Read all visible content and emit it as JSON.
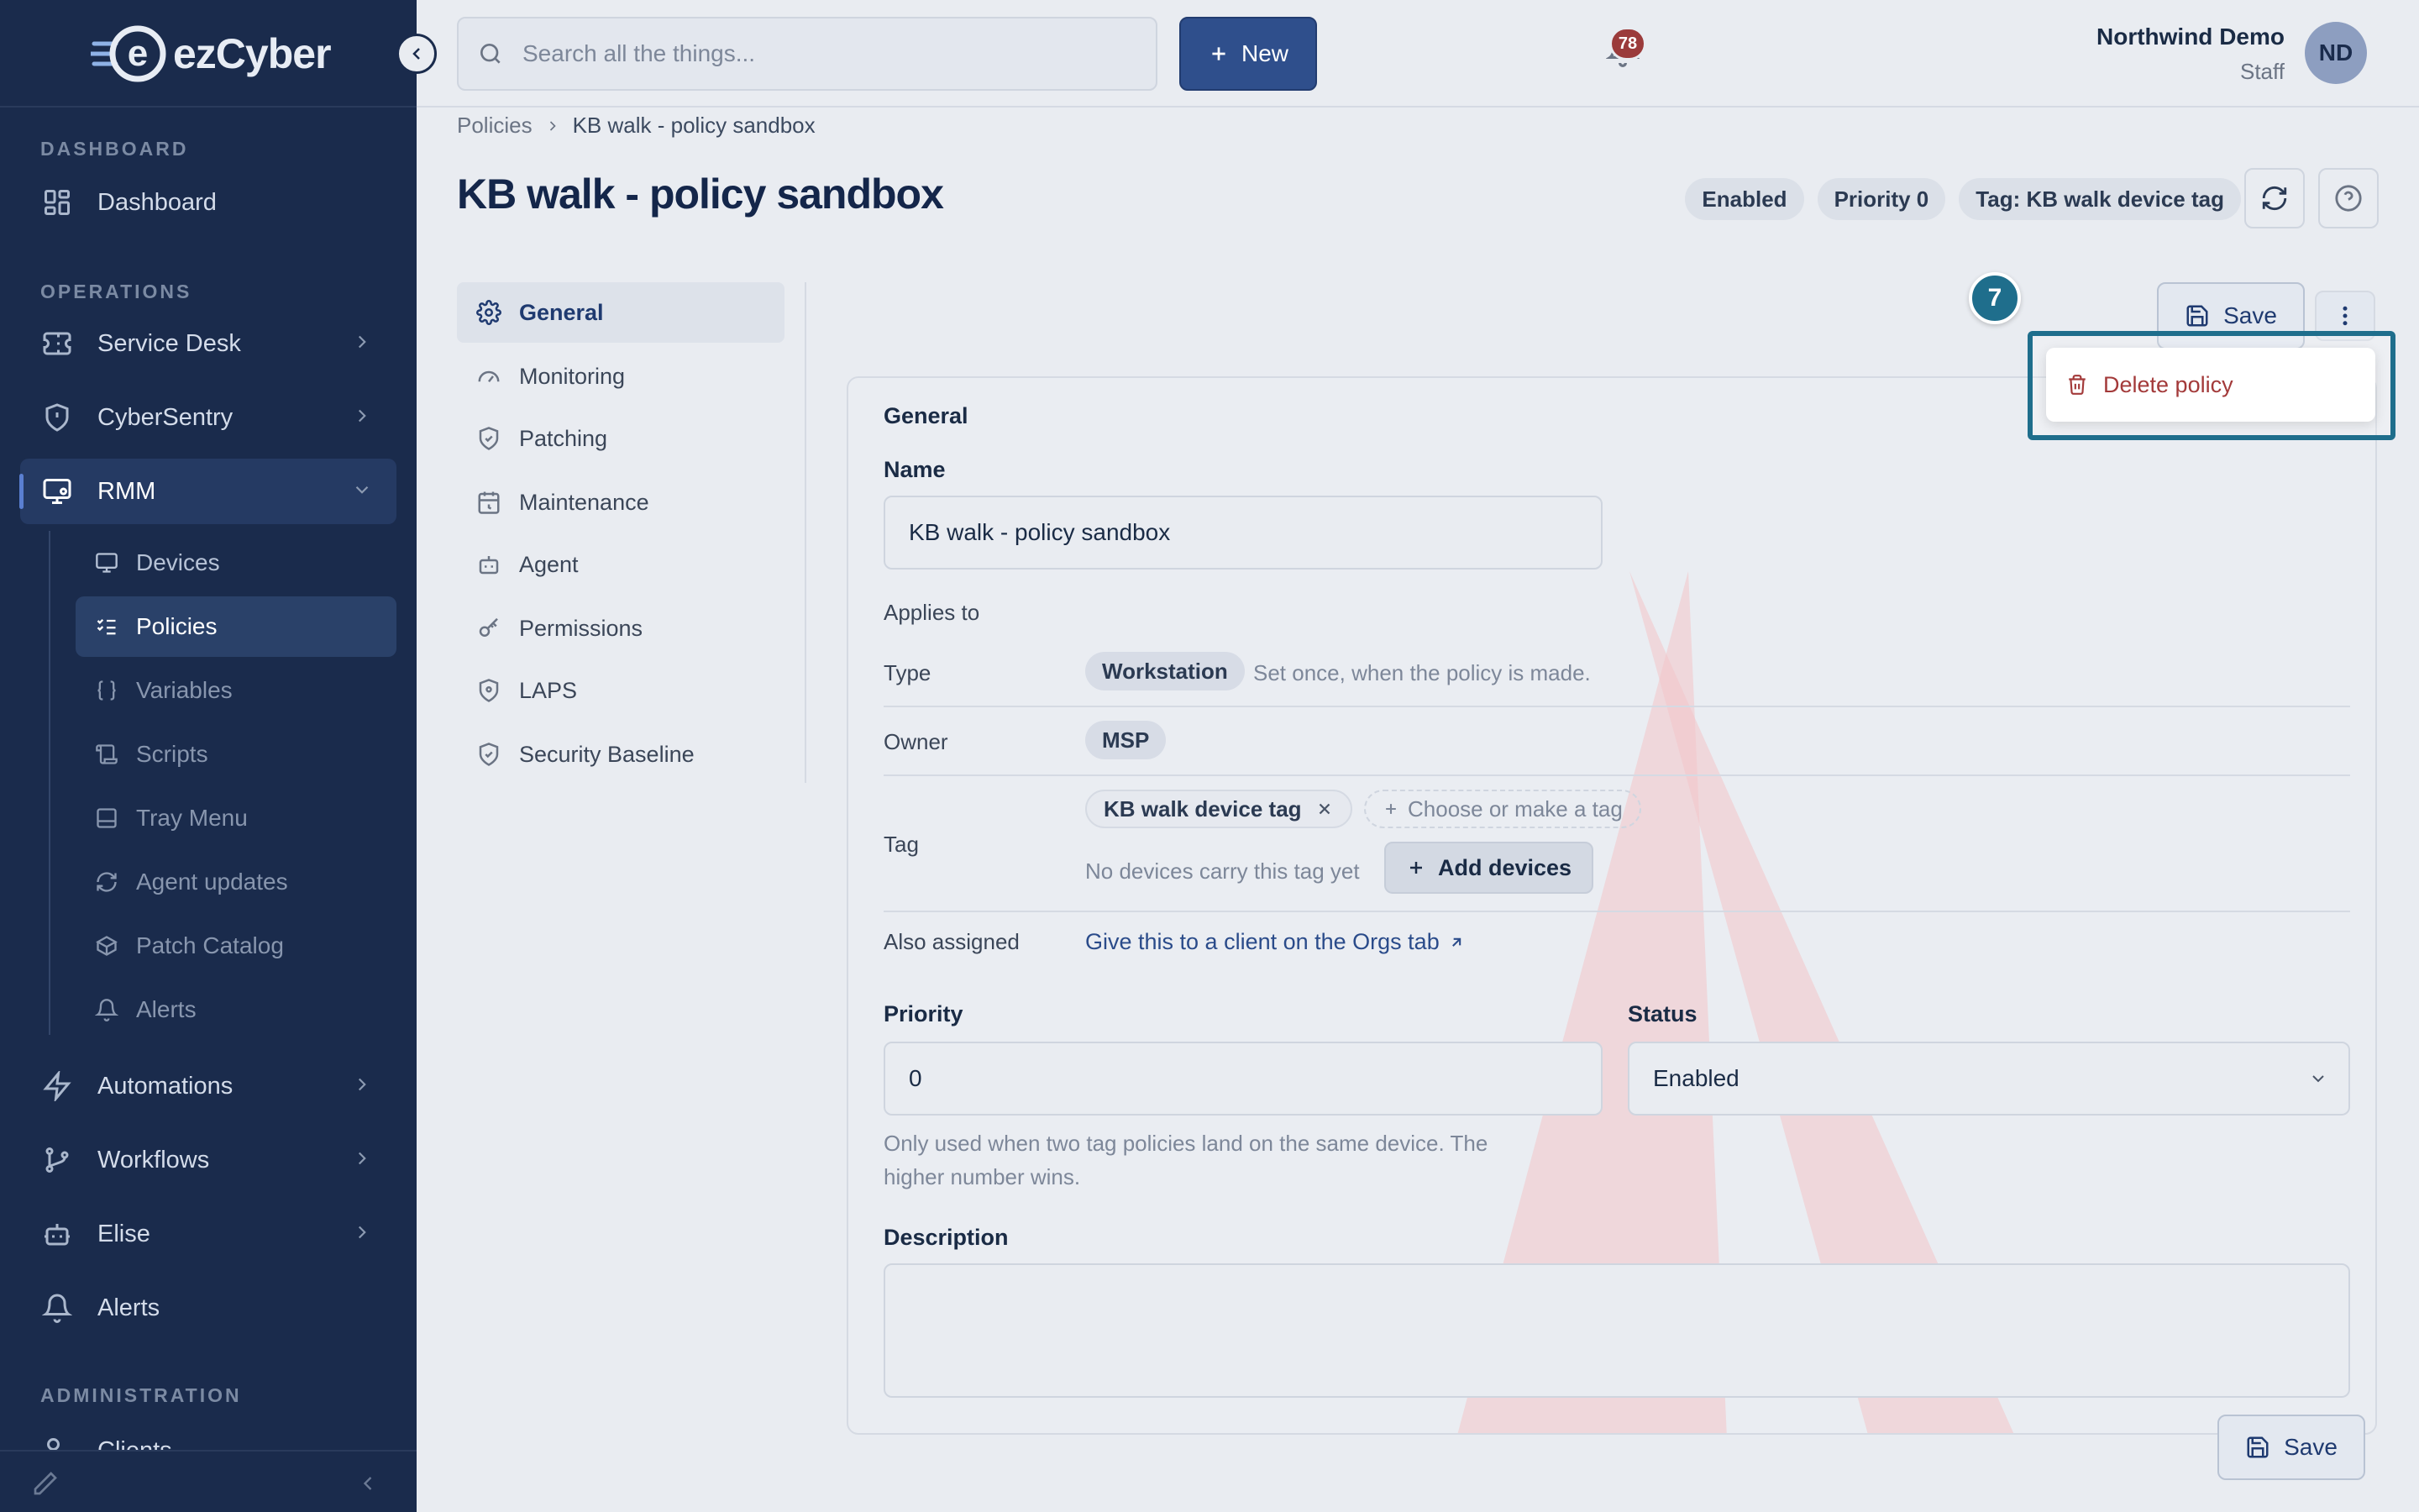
{
  "app": {
    "brand_prefix": "e",
    "brand_name": "ezCyber"
  },
  "sidebar": {
    "sections": {
      "dashboard": "DASHBOARD",
      "operations": "OPERATIONS",
      "administration": "ADMINISTRATION"
    },
    "items": {
      "dashboard": "Dashboard",
      "service_desk": "Service Desk",
      "cybersentry": "CyberSentry",
      "rmm": "RMM",
      "automations": "Automations",
      "workflows": "Workflows",
      "elise": "Elise",
      "alerts": "Alerts",
      "clients": "Clients"
    },
    "rmm_children": [
      "Devices",
      "Policies",
      "Variables",
      "Scripts",
      "Tray Menu",
      "Agent updates",
      "Patch Catalog",
      "Alerts"
    ],
    "active_item": "RMM",
    "active_child": "Policies"
  },
  "topbar": {
    "search_placeholder": "Search all the things...",
    "new_label": "New",
    "notification_count": "78",
    "user_name": "Northwind Demo",
    "user_role": "Staff",
    "avatar_initials": "ND"
  },
  "header": {
    "breadcrumb_root": "Policies",
    "breadcrumb_current": "KB walk - policy sandbox",
    "title": "KB walk - policy sandbox",
    "pills": [
      "Enabled",
      "Priority 0",
      "Tag: KB walk device tag"
    ]
  },
  "sections": [
    "General",
    "Monitoring",
    "Patching",
    "Maintenance",
    "Agent",
    "Permissions",
    "LAPS",
    "Security Baseline"
  ],
  "active_section": "General",
  "actions": {
    "save_label": "Save",
    "step_number": "7",
    "menu_delete": "Delete policy"
  },
  "form": {
    "card_title": "General",
    "name_label": "Name",
    "name_value": "KB walk - policy sandbox",
    "applies_to": "Applies to",
    "type_label": "Type",
    "type_value": "Workstation",
    "type_hint": "Set once, when the policy is made.",
    "owner_label": "Owner",
    "owner_value": "MSP",
    "tag_label": "Tag",
    "tag_value": "KB walk device tag",
    "tag_add_placeholder": "Choose or make a tag",
    "tag_empty_note": "No devices carry this tag yet",
    "add_devices_label": "Add devices",
    "also_assigned_label": "Also assigned",
    "also_assigned_link": "Give this to a client on the Orgs tab",
    "priority_label": "Priority",
    "priority_value": "0",
    "priority_help_line1": "Only used when two tag policies land on the same device. The",
    "priority_help_line2": "higher number wins.",
    "status_label": "Status",
    "status_value": "Enabled",
    "description_label": "Description",
    "description_value": ""
  },
  "colors": {
    "sidebar_bg": "#1a2b4c",
    "primary": "#2f4f8c",
    "highlight": "#1f6e8c",
    "danger": "#a33a3a",
    "badge": "#9b3b3b"
  }
}
